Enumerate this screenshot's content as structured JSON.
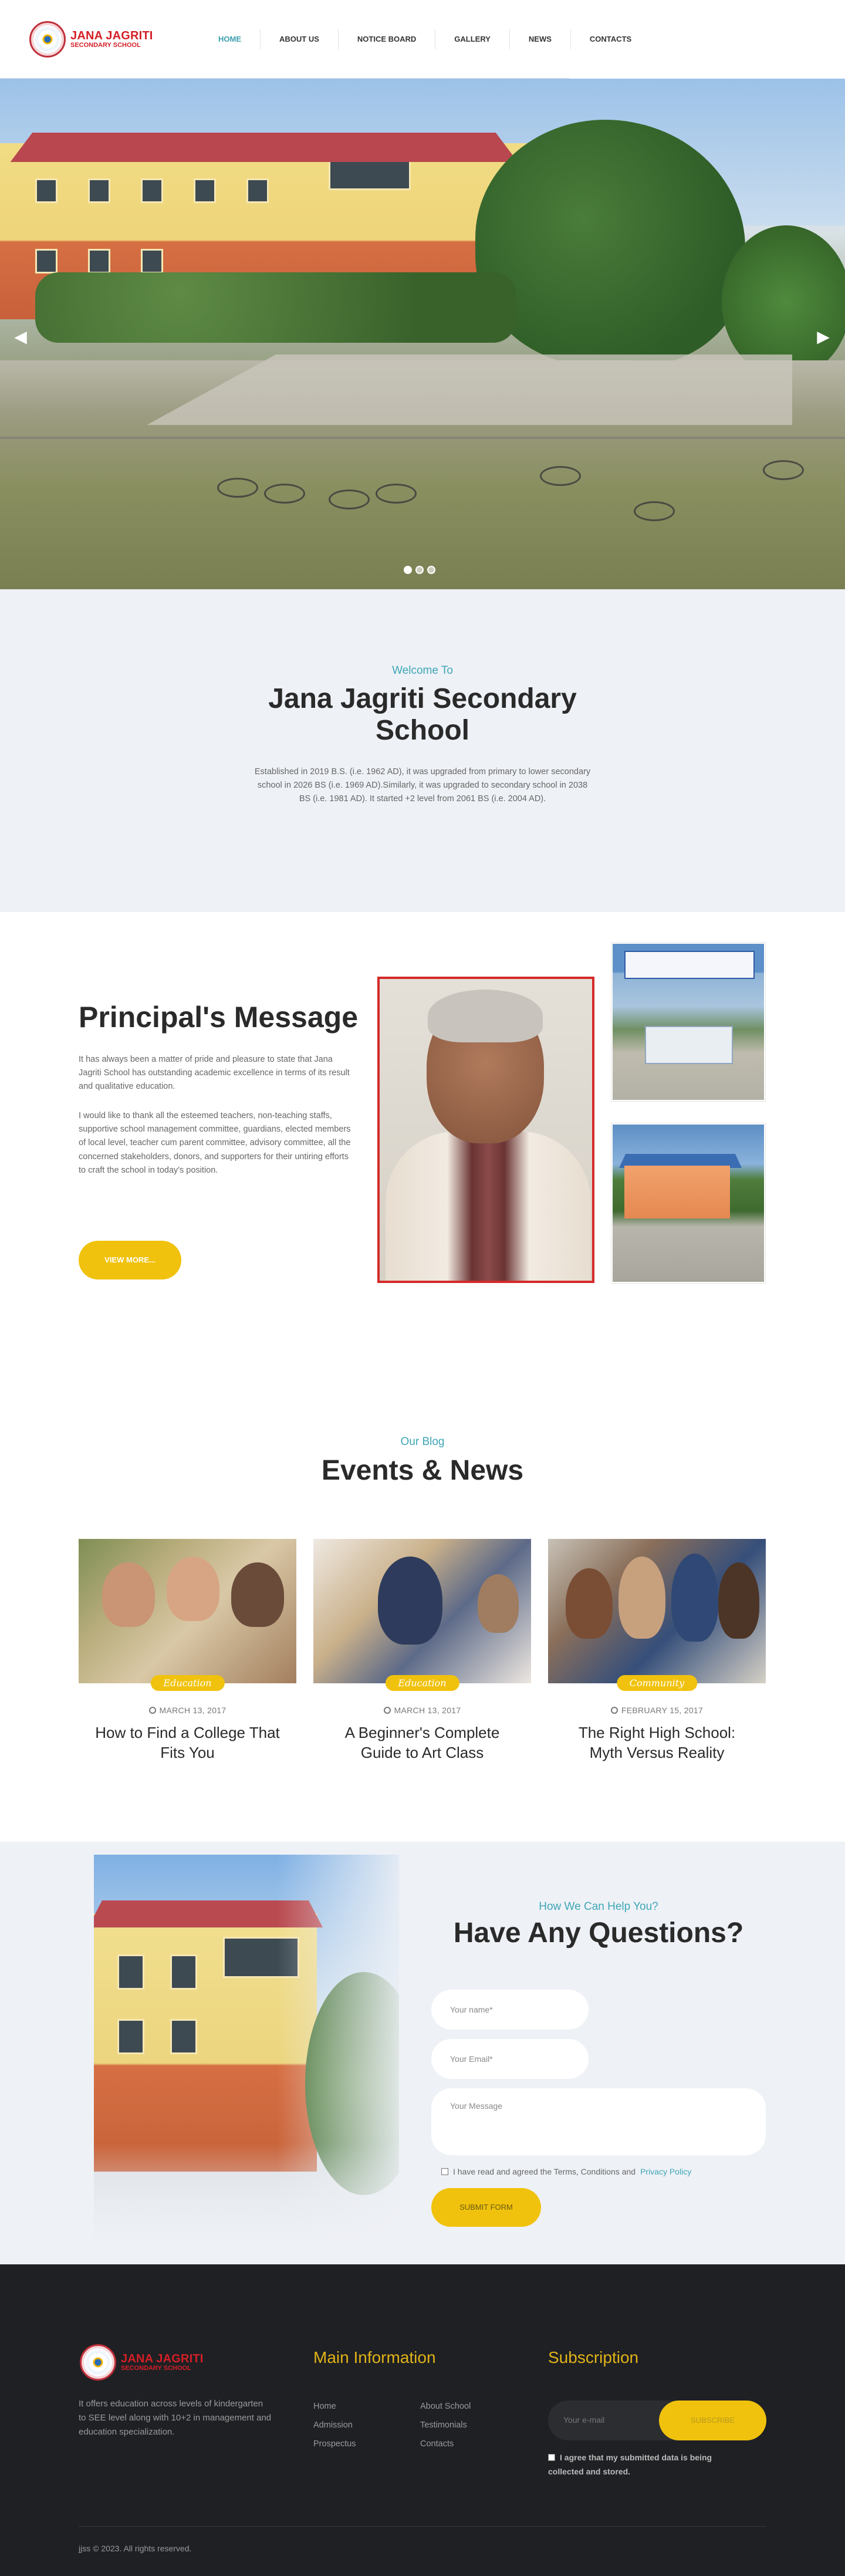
{
  "brand": {
    "line1": "JANA JAGRITI",
    "line2": "SECONDARY SCHOOL",
    "accent": "#d41f26"
  },
  "nav": {
    "items": [
      {
        "label": "HOME"
      },
      {
        "label": "ABOUT US"
      },
      {
        "label": "NOTICE BOARD"
      },
      {
        "label": "GALLERY"
      },
      {
        "label": "NEWS"
      },
      {
        "label": "CONTACTS"
      }
    ],
    "active": "HOME",
    "active_color": "#3a9fb0"
  },
  "hero": {
    "slide_count": 3,
    "active_slide": 1,
    "prev_icon": "chevron-left-icon",
    "next_icon": "chevron-right-icon"
  },
  "welcome": {
    "eyebrow": "Welcome To",
    "title": "Jana Jagriti Secondary School",
    "body": "Established in 2019 B.S. (i.e. 1962 AD), it was upgraded from primary to lower secondary school in 2026 BS (i.e. 1969 AD).Similarly, it was upgraded to secondary school in 2038 BS (i.e. 1981 AD). It started +2 level from 2061 BS (i.e. 2004 AD)."
  },
  "principal": {
    "title": "Principal's Message",
    "p1": "It has always been a matter of pride and pleasure to state that Jana Jagriti School has outstanding academic excellence in terms of its result and qualitative education.",
    "p2": "I would like to thank all the esteemed teachers, non-teaching staffs, supportive school management committee, guardians, elected members of local level, teacher cum parent committee, advisory committee, all the concerned stakeholders, donors, and supporters for their untiring efforts to craft the school in today's position.",
    "button": "VIEW MORE..."
  },
  "events": {
    "eyebrow": "Our Blog",
    "title": "Events & News",
    "cards": [
      {
        "tag": "Education",
        "date": "MARCH 13, 2017",
        "title": "How to Find a College That Fits You"
      },
      {
        "tag": "Education",
        "date": "MARCH 13, 2017",
        "title": "A Beginner's Complete Guide to Art Class"
      },
      {
        "tag": "Community",
        "date": "FEBRUARY 15, 2017",
        "title": "The Right High School: Myth Versus Reality"
      }
    ]
  },
  "contact": {
    "eyebrow": "How We Can Help You?",
    "title": "Have Any Questions?",
    "name_placeholder": "Your name*",
    "email_placeholder": "Your Email*",
    "message_placeholder": "Your Message",
    "agree_text": "I have read and agreed the Terms, Conditions and",
    "agree_link": "Privacy Policy",
    "submit": "SUBMIT FORM"
  },
  "footer": {
    "description": "It offers education across levels of kindergarten to SEE level along with 10+2 in management and education specialization.",
    "main_info_title": "Main Information",
    "links_col1": [
      "Home",
      "Admission",
      "Prospectus"
    ],
    "links_col2": [
      "About School",
      "Testimonials",
      "Contacts"
    ],
    "subscription_title": "Subscription",
    "email_placeholder": "Your e-mail",
    "subscribe": "SUBSCRIBE",
    "agree": "I agree that my submitted data is being collected and stored.",
    "copyright": "jjss © 2023. All rights reserved."
  }
}
